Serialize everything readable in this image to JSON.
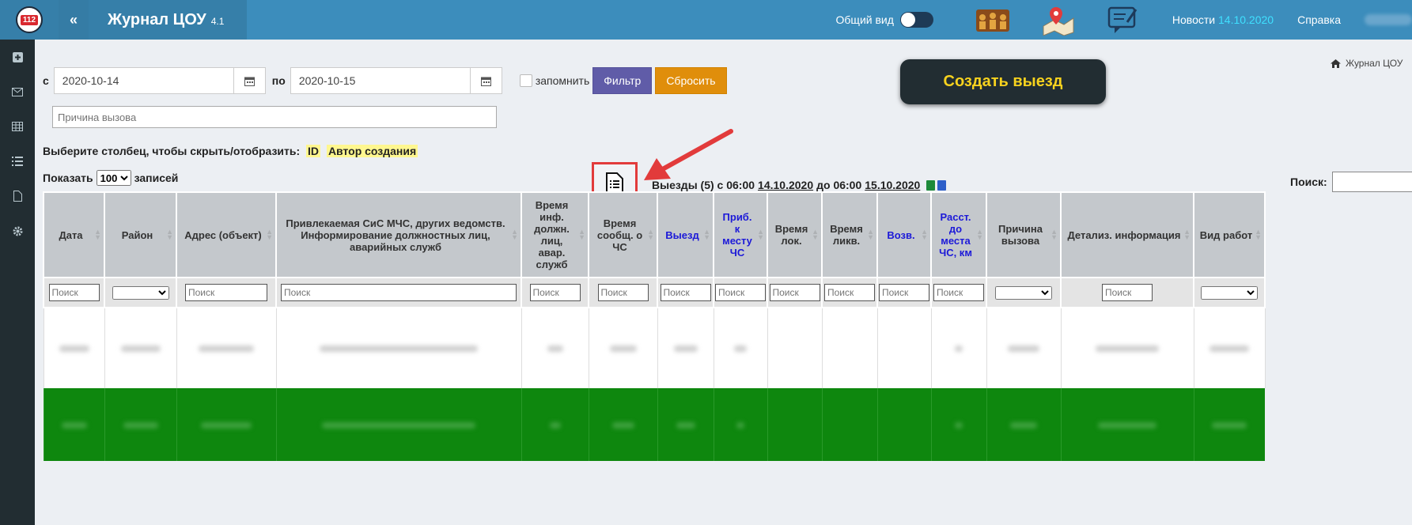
{
  "header": {
    "logo_text": "112",
    "collapse": "«",
    "title": "Журнал ЦОУ",
    "version": "4.1",
    "general_view_label": "Общий вид",
    "news_label": "Новости",
    "news_date": "14.10.2020",
    "help_label": "Справка"
  },
  "filters": {
    "from_label": "с",
    "from_value": "2020-10-14",
    "to_label": "по",
    "to_value": "2020-10-15",
    "remember_label": "запомнить",
    "filter_button": "Фильтр",
    "reset_button": "Сбросить",
    "reason_placeholder": "Причина вызова"
  },
  "create_button": "Создать выезд",
  "breadcrumb": "Журнал ЦОУ",
  "column_toggle": {
    "label": "Выберите столбец, чтобы скрыть/отобразить:",
    "id": "ID",
    "author": "Автор создания"
  },
  "report": {
    "prefix": "Выезды (5) с 06:00",
    "date_from": "14.10.2020",
    "mid": "до 06:00",
    "date_to": "15.10.2020"
  },
  "table_controls": {
    "show_label": "Показать",
    "page_size": "100",
    "entries_label": "записей",
    "search_label": "Поиск:"
  },
  "columns": [
    {
      "label": "Дата",
      "blue": false
    },
    {
      "label": "Район",
      "blue": false
    },
    {
      "label": "Адрес (объект)",
      "blue": false
    },
    {
      "label": "Привлекаемая СиС МЧС, других ведомств. Информирование должностных лиц, аварийных служб",
      "blue": false
    },
    {
      "label": "Время инф. должн. лиц, авар. служб",
      "blue": false
    },
    {
      "label": "Время сообщ. о ЧС",
      "blue": false
    },
    {
      "label": "Выезд",
      "blue": true
    },
    {
      "label": "Приб. к месту ЧС",
      "blue": true
    },
    {
      "label": "Время лок.",
      "blue": false
    },
    {
      "label": "Время ликв.",
      "blue": false
    },
    {
      "label": "Возв.",
      "blue": true
    },
    {
      "label": "Расст. до места ЧС, км",
      "blue": true
    },
    {
      "label": "Причина вызова",
      "blue": false
    },
    {
      "label": "Детализ. информация",
      "blue": false
    },
    {
      "label": "Вид работ",
      "blue": false
    }
  ],
  "filter_placeholder": "Поиск",
  "colors": {
    "topbar": "#3c8dbc",
    "sidebar": "#222d32",
    "filter_button": "#605ca8",
    "reset_button": "#e08e0b",
    "create_text": "#f7d21e",
    "row_green": "#0e870e",
    "highlight": "#e23b3b"
  }
}
